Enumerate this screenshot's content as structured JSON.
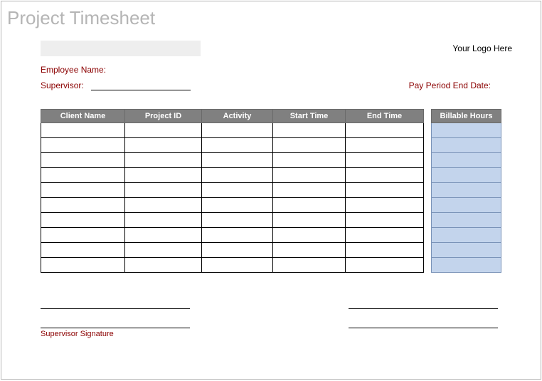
{
  "title": "Project Timesheet",
  "logo_placeholder": "Your Logo Here",
  "labels": {
    "employee_name": "Employee Name:",
    "supervisor": "Supervisor:",
    "pay_period": "Pay Period End Date:",
    "supervisor_signature": "Supervisor Signature"
  },
  "columns": {
    "client_name": "Client Name",
    "project_id": "Project ID",
    "activity": "Activity",
    "start_time": "Start Time",
    "end_time": "End Time",
    "billable_hours": "Billable Hours"
  },
  "chart_data": {
    "type": "table",
    "columns": [
      "Client Name",
      "Project ID",
      "Activity",
      "Start Time",
      "End Time",
      "Billable Hours"
    ],
    "rows": [
      [
        "",
        "",
        "",
        "",
        "",
        ""
      ],
      [
        "",
        "",
        "",
        "",
        "",
        ""
      ],
      [
        "",
        "",
        "",
        "",
        "",
        ""
      ],
      [
        "",
        "",
        "",
        "",
        "",
        ""
      ],
      [
        "",
        "",
        "",
        "",
        "",
        ""
      ],
      [
        "",
        "",
        "",
        "",
        "",
        ""
      ],
      [
        "",
        "",
        "",
        "",
        "",
        ""
      ],
      [
        "",
        "",
        "",
        "",
        "",
        ""
      ],
      [
        "",
        "",
        "",
        "",
        "",
        ""
      ],
      [
        "",
        "",
        "",
        "",
        "",
        ""
      ]
    ],
    "title": "Project Timesheet"
  }
}
